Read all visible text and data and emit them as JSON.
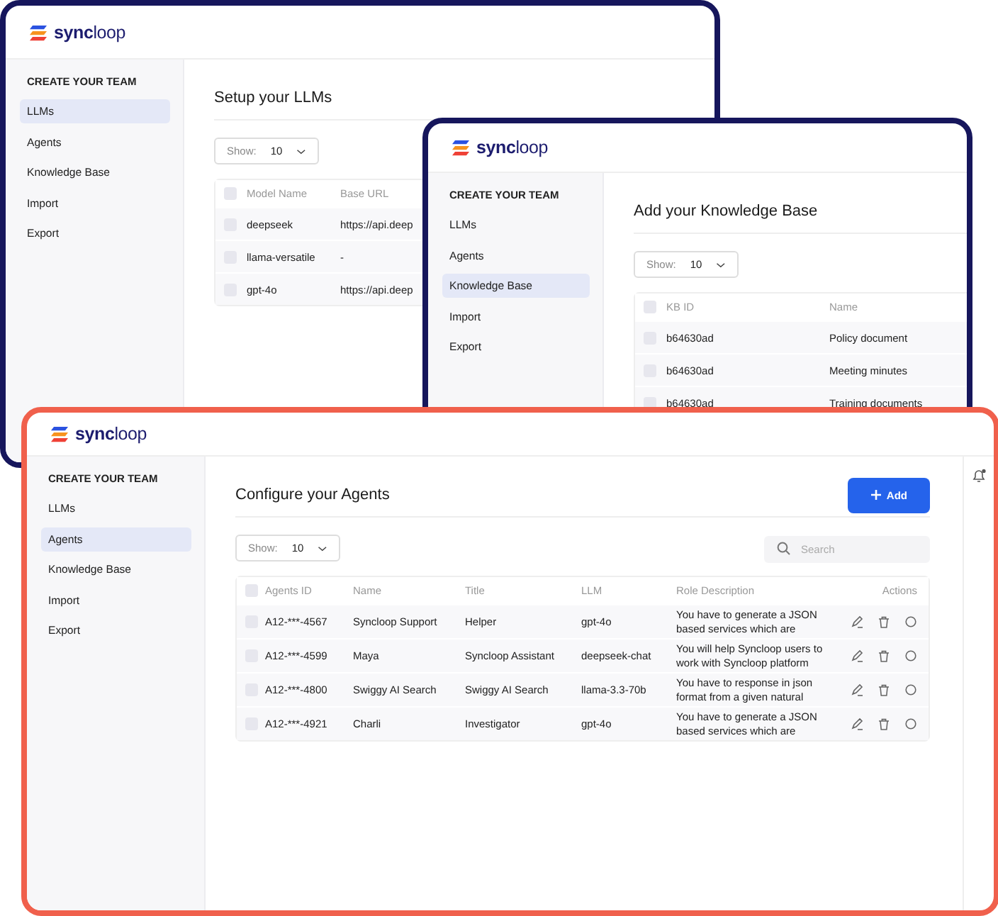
{
  "windows": [
    {
      "color": "#16165c",
      "brand": "**sync**loop",
      "sidebar": {
        "heading": "CREATE YOUR TEAM",
        "items": [
          {
            "label": "LLMs",
            "selected": true
          },
          {
            "label": "Agents",
            "selected": false
          },
          {
            "label": "Knowledge Base",
            "selected": false
          },
          {
            "label": "Import",
            "selected": false
          },
          {
            "label": "Export",
            "selected": false
          }
        ]
      },
      "title": "Setup your LLMs",
      "show_label": "Show:",
      "show_value": "10",
      "table": {
        "select_all_checked": false,
        "row_actions": false,
        "columns": [
          "Model Name",
          "Base URL"
        ],
        "rows": [
          {
            "checked": false,
            "cells": [
              "deepseek",
              "https://api.deep"
            ]
          },
          {
            "checked": false,
            "cells": [
              "llama-versatile",
              "-"
            ]
          },
          {
            "checked": false,
            "cells": [
              "gpt-4o",
              "https://api.deep"
            ]
          }
        ]
      }
    },
    {
      "color": "#16165c",
      "brand": "**sync**loop",
      "sidebar": {
        "heading": "CREATE YOUR TEAM",
        "items": [
          {
            "label": "LLMs",
            "selected": false
          },
          {
            "label": "Agents",
            "selected": false
          },
          {
            "label": "Knowledge Base",
            "selected": true
          },
          {
            "label": "Import",
            "selected": false
          },
          {
            "label": "Export",
            "selected": false
          }
        ]
      },
      "title": "Add your Knowledge Base",
      "show_label": "Show:",
      "show_value": "10",
      "table": {
        "select_all_checked": false,
        "row_actions": false,
        "columns": [
          "KB ID",
          "Name"
        ],
        "rows": [
          {
            "checked": false,
            "cells": [
              "b64630ad",
              "Policy document"
            ]
          },
          {
            "checked": false,
            "cells": [
              "b64630ad",
              "Meeting minutes"
            ]
          },
          {
            "checked": false,
            "cells": [
              "b64630ad",
              "Training documents"
            ]
          }
        ]
      }
    },
    {
      "color": "#f0604c",
      "brand": "**sync**loop",
      "sidebar": {
        "heading": "CREATE YOUR TEAM",
        "items": [
          {
            "label": "LLMs",
            "selected": false
          },
          {
            "label": "Agents",
            "selected": true
          },
          {
            "label": "Knowledge Base",
            "selected": false
          },
          {
            "label": "Import",
            "selected": false
          },
          {
            "label": "Export",
            "selected": false
          }
        ]
      },
      "title": "Configure your Agents",
      "add_button": "Add",
      "search": {
        "placeholder": "Search"
      },
      "show_label": "Show:",
      "show_value": "10",
      "table": {
        "select_all_checked": false,
        "row_actions": true,
        "columns": [
          "Agents ID",
          "Name",
          "Title",
          "LLM",
          "Role Description",
          "Actions"
        ],
        "rows": [
          {
            "checked": false,
            "cells": [
              "A12-***-4567",
              "Syncloop Support",
              "Helper",
              "gpt-4o",
              "You have to generate a JSON based services which are"
            ]
          },
          {
            "checked": false,
            "cells": [
              "A12-***-4599",
              "Maya",
              "Syncloop Assistant",
              "deepseek-chat",
              "You will help Syncloop users to work with Syncloop platform"
            ]
          },
          {
            "checked": false,
            "cells": [
              "A12-***-4800",
              "Swiggy AI Search",
              "Swiggy AI Search",
              "llama-3.3-70b",
              "You have to response in json format from a given natural"
            ]
          },
          {
            "checked": false,
            "cells": [
              "A12-***-4921",
              "Charli",
              "Investigator",
              "gpt-4o",
              "You have to generate a JSON based services which are"
            ]
          }
        ]
      }
    }
  ]
}
